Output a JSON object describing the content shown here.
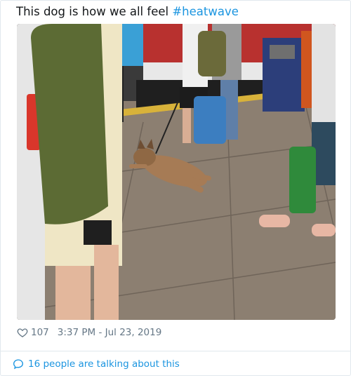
{
  "tweet": {
    "text": "This dog is how we all feel",
    "hashtag": "#heatwave"
  },
  "media": {
    "icon": "photo",
    "colors": {
      "floor": "#8a7c6e",
      "dog": "#a67b55",
      "bag": "#2f8a3b"
    }
  },
  "meta": {
    "like_icon": "heart-icon",
    "likes": "107",
    "timestamp": "3:37 PM - Jul 23, 2019"
  },
  "conversation": {
    "icon": "chat-bubble-icon",
    "label": "16 people are talking about this"
  },
  "colors": {
    "link": "#1b95e0",
    "muted": "#657786",
    "border": "#e1e8ed"
  }
}
